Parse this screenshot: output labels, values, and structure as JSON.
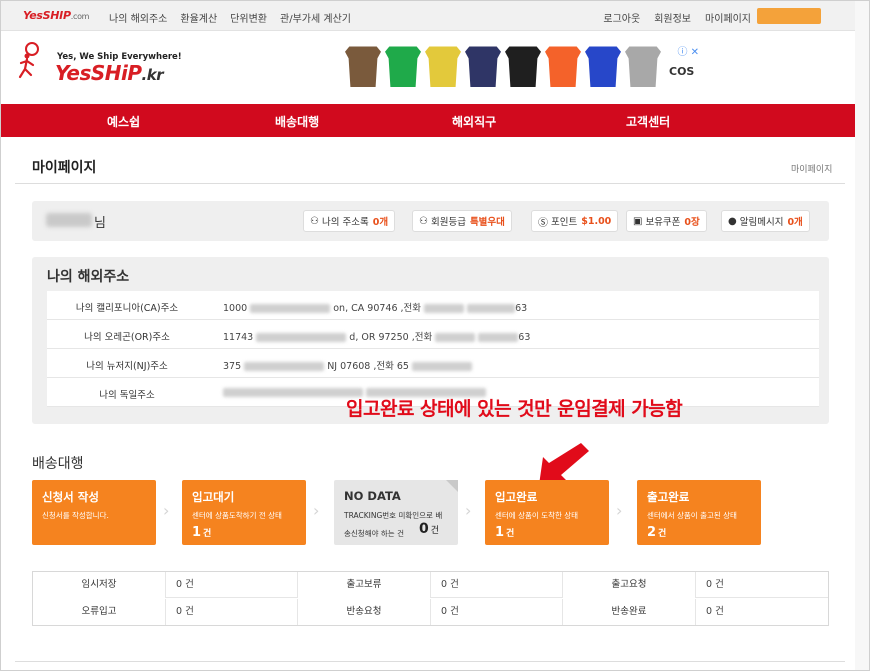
{
  "topbar": {
    "logo": "YesSHIP",
    "logo_suffix": ".com",
    "links": [
      "나의 해외주소",
      "환율계산",
      "단위변환",
      "관/부가세 계산기"
    ],
    "right_links": [
      "로그아웃",
      "회원정보",
      "마이페이지"
    ]
  },
  "header": {
    "tagline": "Yes, We Ship Everywhere!",
    "logo_main": "YesSHiP",
    "logo_kr": ".kr",
    "ad": {
      "brand": "COS",
      "close": "ⓘ ✕",
      "items": [
        {
          "color": "#7a5a3c"
        },
        {
          "color": "#1faa4a"
        },
        {
          "color": "#e3c93b"
        },
        {
          "color": "#2f3566"
        },
        {
          "color": "#1f1f1f"
        },
        {
          "color": "#f4622a"
        },
        {
          "color": "#2747c9"
        },
        {
          "color": "#a8a8a8"
        }
      ]
    }
  },
  "nav": {
    "items": [
      "예스쉽",
      "배송대행",
      "해외직구",
      "고객센터"
    ],
    "color": "#d10a1e"
  },
  "page": {
    "title": "마이페이지",
    "breadcrumb": "마이페이지"
  },
  "user": {
    "suffix": "님",
    "pills": [
      {
        "icon": "⚇",
        "label": "나의 주소록",
        "value": "0개"
      },
      {
        "icon": "⚇",
        "label": "회원등급",
        "value": "특별우대"
      },
      {
        "icon": "Ⓢ",
        "label": "포인트",
        "value": "$1.00"
      },
      {
        "icon": "▣",
        "label": "보유쿠폰",
        "value": "0장"
      },
      {
        "icon": "●",
        "label": "알림메시지",
        "value": "0개"
      }
    ]
  },
  "address": {
    "title": "나의 해외주소",
    "rows": [
      {
        "label": "나의 캘리포니아(CA)주소",
        "a": "1000",
        "b": "on, CA   90746  ,전화",
        "c": "63"
      },
      {
        "label": "나의 오레곤(OR)주소",
        "a": "11743",
        "b": "d, OR   97250  ,전화",
        "c": "63"
      },
      {
        "label": "나의 뉴저지(NJ)주소",
        "a": "375",
        "b": "NJ   07608  ,전화 65",
        "c": ""
      },
      {
        "label": "나의 독일주소",
        "a": "",
        "b": "",
        "c": ""
      }
    ]
  },
  "annotation": {
    "text": "입고완료 상태에 있는 것만 운임결제 가능함"
  },
  "delivery": {
    "title": "배송대행",
    "cards": [
      {
        "title": "신청서 작성",
        "desc": "신청서를 작성합니다.",
        "count": "",
        "unit": ""
      },
      {
        "title": "입고대기",
        "desc": "센터에 상품도착하기 전 상태",
        "count": "1",
        "unit": "건"
      },
      {
        "title": "NO DATA",
        "desc": "TRACKING번호 미확인으로 배",
        "desc2": "송신청해야 하는 건",
        "count": "0",
        "unit": "건"
      },
      {
        "title": "입고완료",
        "desc": "센터에 상품이 도착한 상태",
        "count": "1",
        "unit": "건"
      },
      {
        "title": "출고완료",
        "desc": "센터에서 상품이 출고된 상태",
        "count": "2",
        "unit": "건"
      }
    ]
  },
  "status": {
    "rows": [
      [
        {
          "label": "임시저장",
          "value": "0 건"
        },
        {
          "label": "출고보류",
          "value": "0 건"
        },
        {
          "label": "출고요청",
          "value": "0 건"
        }
      ],
      [
        {
          "label": "오류입고",
          "value": "0 건"
        },
        {
          "label": "반송요청",
          "value": "0 건"
        },
        {
          "label": "반송완료",
          "value": "0 건"
        }
      ]
    ]
  }
}
